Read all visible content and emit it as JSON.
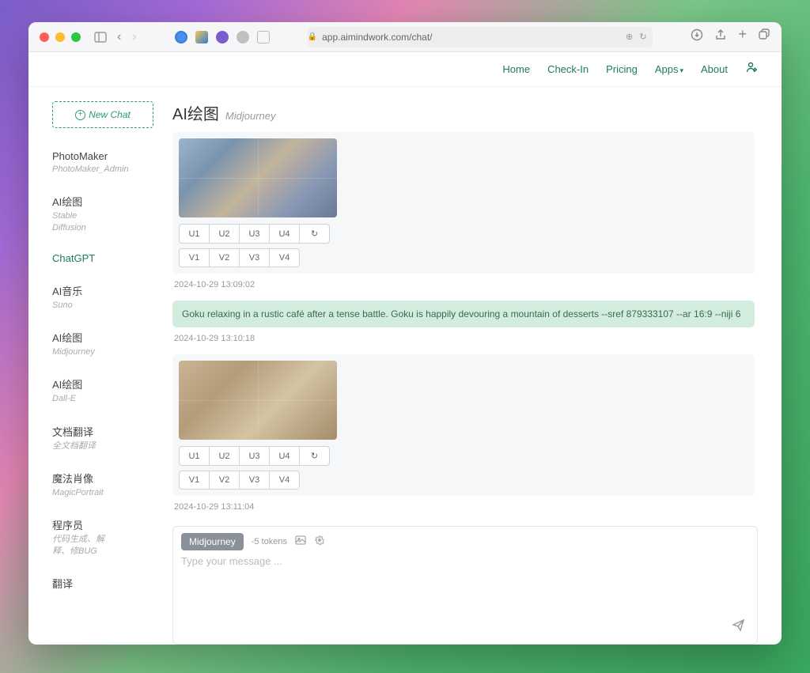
{
  "browser": {
    "url": "app.aimindwork.com/chat/"
  },
  "topnav": {
    "home": "Home",
    "checkin": "Check-In",
    "pricing": "Pricing",
    "apps": "Apps",
    "about": "About"
  },
  "sidebar": {
    "new_chat": "New Chat",
    "items": [
      {
        "title": "PhotoMaker",
        "sub": "PhotoMaker_Admin"
      },
      {
        "title": "AI绘图",
        "sub": "Stable\nDiffusion"
      },
      {
        "title": "ChatGPT",
        "sub": ""
      },
      {
        "title": "AI音乐",
        "sub": "Suno"
      },
      {
        "title": "AI绘图",
        "sub": "Midjourney"
      },
      {
        "title": "AI绘图",
        "sub": "Dall-E"
      },
      {
        "title": "文档翻译",
        "sub": "全文档翻译"
      },
      {
        "title": "魔法肖像",
        "sub": "MagicPortrait"
      },
      {
        "title": "程序员",
        "sub": "代码生成、解\n释、修BUG"
      },
      {
        "title": "翻译",
        "sub": ""
      }
    ],
    "active_index": 2
  },
  "main": {
    "title": "AI绘图",
    "subtitle": "Midjourney"
  },
  "messages": [
    {
      "type": "result",
      "image_style": "cool",
      "u_buttons": [
        "U1",
        "U2",
        "U3",
        "U4"
      ],
      "v_buttons": [
        "V1",
        "V2",
        "V3",
        "V4"
      ],
      "timestamp": "2024-10-29 13:09:02"
    },
    {
      "type": "user",
      "text": "Goku relaxing in a rustic café after a tense battle. Goku is happily devouring a mountain of desserts --sref 879333107 --ar 16:9 --niji 6",
      "timestamp": "2024-10-29 13:10:18"
    },
    {
      "type": "result",
      "image_style": "warm",
      "u_buttons": [
        "U1",
        "U2",
        "U3",
        "U4"
      ],
      "v_buttons": [
        "V1",
        "V2",
        "V3",
        "V4"
      ],
      "timestamp": "2024-10-29 13:11:04"
    }
  ],
  "composer": {
    "tag": "Midjourney",
    "tokens": "-5 tokens",
    "placeholder": "Type your message ..."
  },
  "icons": {
    "refresh": "↻"
  }
}
